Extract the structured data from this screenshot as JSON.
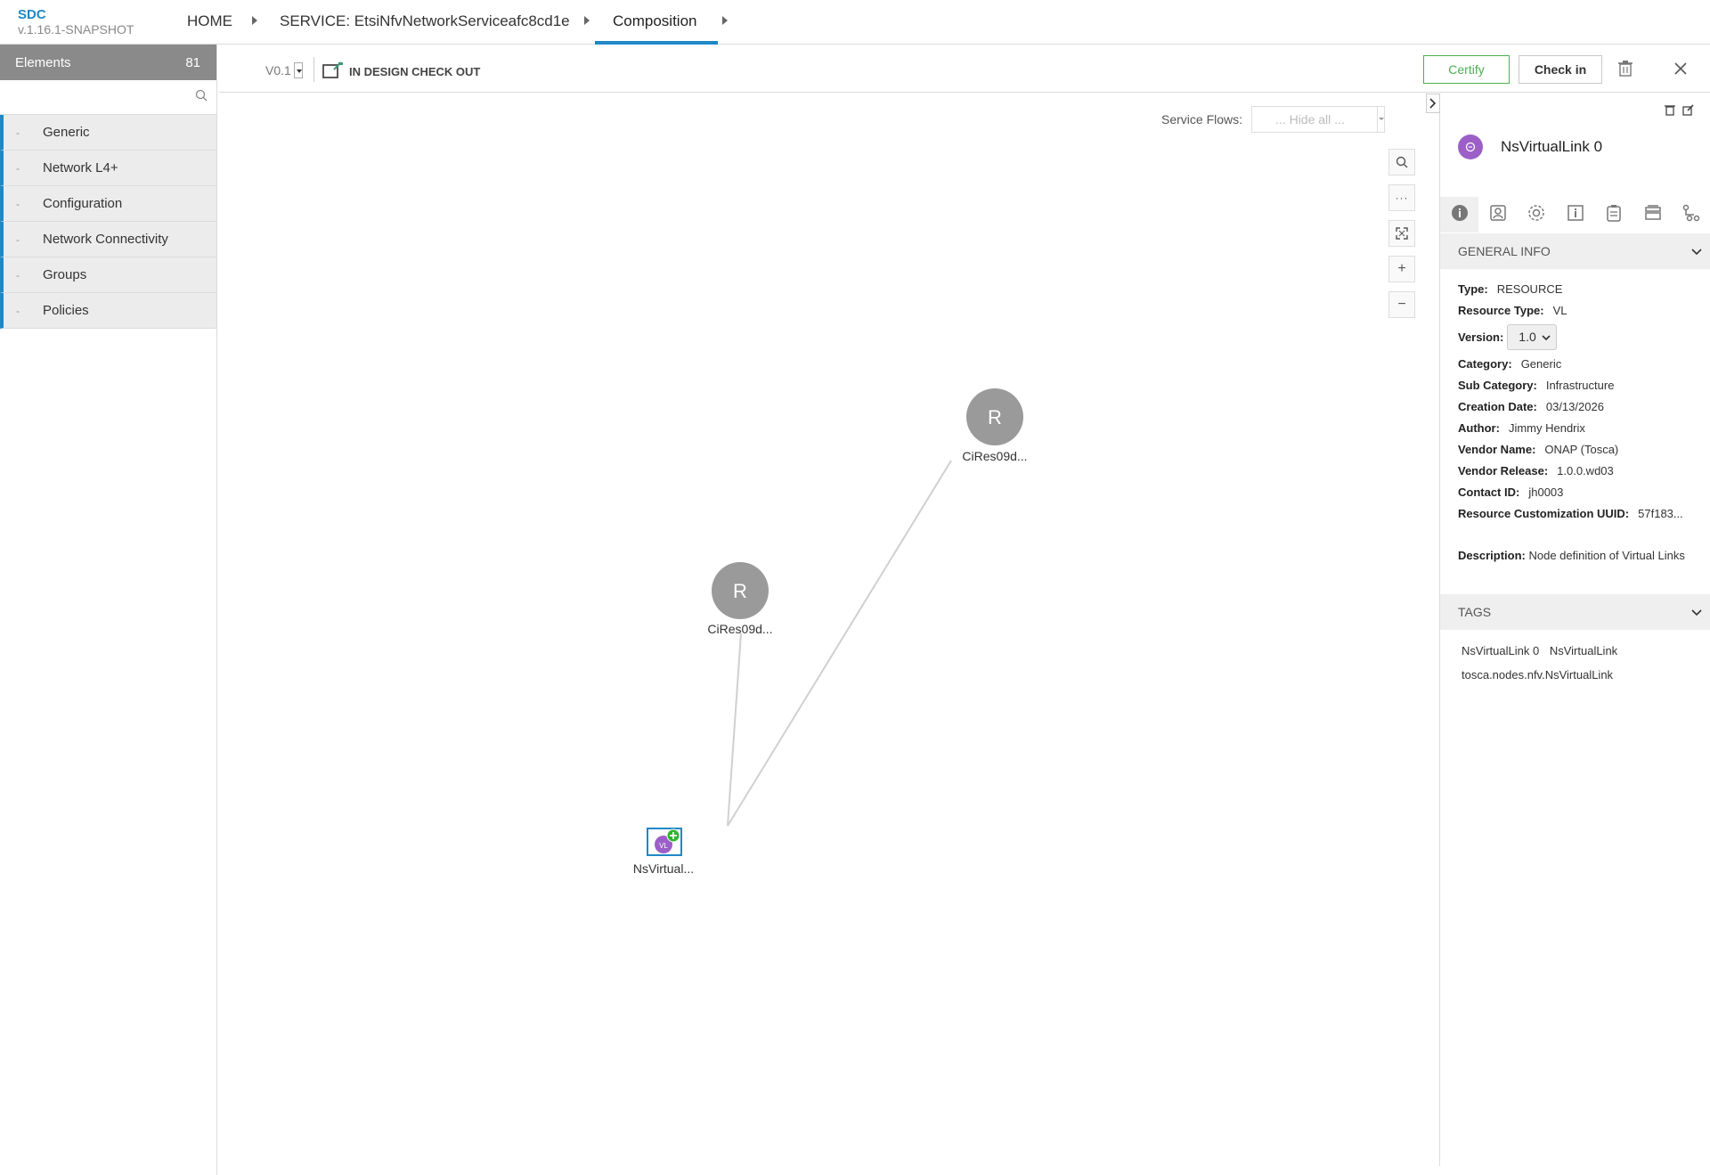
{
  "app": {
    "name": "SDC",
    "version": "v.1.16.1-SNAPSHOT"
  },
  "breadcrumb": {
    "home": "HOME",
    "service": "SERVICE: EtsiNfvNetworkServiceafc8cd1e",
    "current": "Composition"
  },
  "palette": {
    "title": "Elements",
    "count": "81",
    "search_placeholder": "",
    "categories": [
      {
        "label": "Generic"
      },
      {
        "label": "Network L4+"
      },
      {
        "label": "Configuration"
      },
      {
        "label": "Network Connectivity"
      },
      {
        "label": "Groups"
      },
      {
        "label": "Policies"
      }
    ]
  },
  "toolbar": {
    "version": "V0.1",
    "state": "IN DESIGN CHECK OUT",
    "certify_label": "Certify",
    "checkin_label": "Check in"
  },
  "canvas": {
    "service_flows_label": "Service Flows:",
    "service_flows_value": "... Hide all ...",
    "zoom_controls": [
      {
        "name": "search-icon",
        "glyph": "⚲"
      },
      {
        "name": "more-icon",
        "glyph": "···"
      },
      {
        "name": "fit-icon",
        "glyph": "⤢"
      },
      {
        "name": "zoom-in-icon",
        "glyph": "+"
      },
      {
        "name": "zoom-out-icon",
        "glyph": "−"
      }
    ],
    "nodes": [
      {
        "id": "n1",
        "letter": "R",
        "label": "CiRes09d..."
      },
      {
        "id": "n2",
        "letter": "R",
        "label": "CiRes09d..."
      },
      {
        "id": "n3",
        "letter": "VL",
        "label": "NsVirtual..."
      }
    ]
  },
  "panel": {
    "title": "NsVirtualLink 0",
    "general_info_label": "GENERAL INFO",
    "info": {
      "type_label": "Type:",
      "type": "RESOURCE",
      "resource_type_label": "Resource Type:",
      "resource_type": "VL",
      "version_label": "Version:",
      "version": "1.0",
      "category_label": "Category:",
      "category": "Generic",
      "sub_category_label": "Sub Category:",
      "sub_category": "Infrastructure",
      "creation_date_label": "Creation Date:",
      "creation_date": "03/13/2026",
      "author_label": "Author:",
      "author": "Jimmy Hendrix",
      "vendor_name_label": "Vendor Name:",
      "vendor_name": "ONAP (Tosca)",
      "vendor_release_label": "Vendor Release:",
      "vendor_release": "1.0.0.wd03",
      "contact_id_label": "Contact ID:",
      "contact_id": "jh0003",
      "uuid_label": "Resource Customization UUID:",
      "uuid": "57f183...",
      "description_label": "Description:",
      "description": "Node definition of Virtual Links"
    },
    "tags_label": "TAGS",
    "tags": [
      "NsVirtualLink 0",
      "NsVirtualLink",
      "tosca.nodes.nfv.NsVirtualLink"
    ]
  },
  "colors": {
    "accent": "#1e88c8",
    "certify": "#4caf50",
    "vl_node": "#9c5fc7",
    "resource_node": "#9a9a9a"
  }
}
